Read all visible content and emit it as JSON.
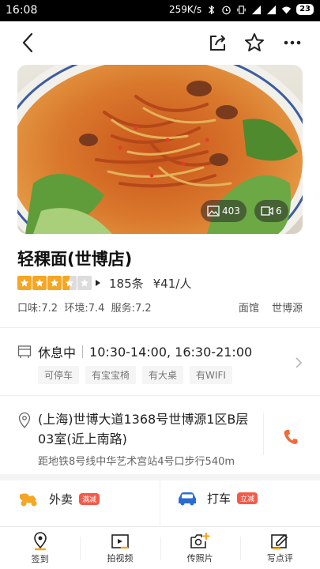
{
  "status_bar": {
    "time": "16:08",
    "speed": "259K/s",
    "battery": "23"
  },
  "nav": {
    "back_icon": "back-arrow-icon",
    "share_icon": "share-icon",
    "favorite_icon": "star-outline-icon",
    "more_icon": "more-icon"
  },
  "hero": {
    "photo_count": "403",
    "video_count": "6"
  },
  "shop": {
    "name": "轻稞面(世博店)",
    "rating_stars": 3.5,
    "review_count": "185条",
    "avg_price": "¥41/人",
    "scores": "口味:7.2  环境:7.4  服务:7.2",
    "category": "面馆",
    "area": "世博源"
  },
  "hours": {
    "status": "休息中",
    "times": "10:30-14:00, 16:30-21:00"
  },
  "facilities": [
    "可停车",
    "有宝宝椅",
    "有大桌",
    "有WIFI"
  ],
  "address": {
    "text": "(上海)世博大道1368号世博源1区B层03室(近上南路)",
    "metro": "距地铁8号线中华艺术宫站4号口步行540m"
  },
  "services": {
    "takeout": {
      "label": "外卖",
      "badge": "满减"
    },
    "taxi": {
      "label": "打车",
      "badge": "立减"
    }
  },
  "bottom_bar": [
    {
      "label": "签到"
    },
    {
      "label": "拍视频"
    },
    {
      "label": "传照片"
    },
    {
      "label": "写点评"
    }
  ],
  "colors": {
    "accent": "#f5a623",
    "phone": "#f26b3a",
    "badge": "#f25b4a"
  }
}
